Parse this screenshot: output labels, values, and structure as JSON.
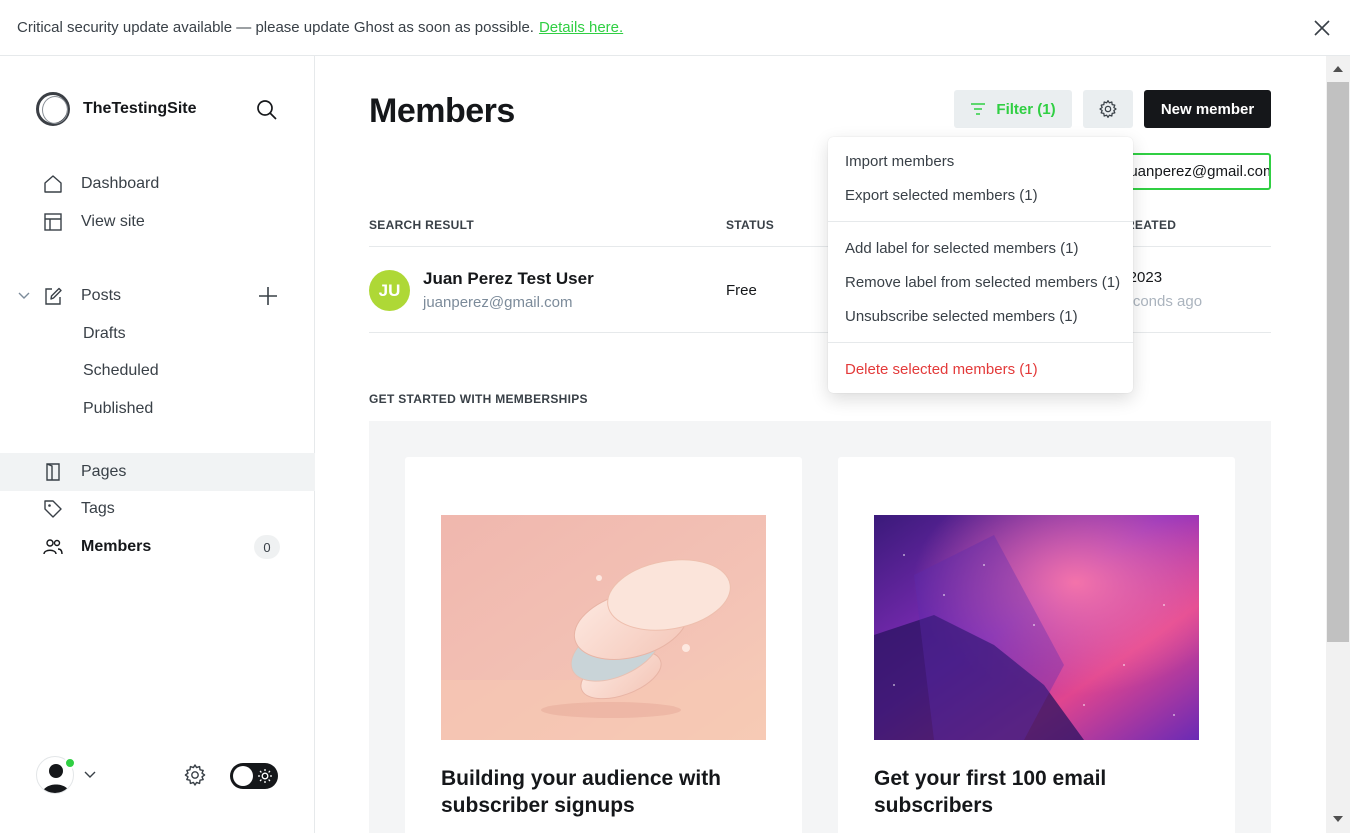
{
  "banner": {
    "message": "Critical security update available — please update Ghost as soon as possible.",
    "link_text": "Details here."
  },
  "sidebar": {
    "site_name": "TheTestingSite",
    "nav": {
      "dashboard": "Dashboard",
      "view_site": "View site",
      "posts": "Posts",
      "drafts": "Drafts",
      "scheduled": "Scheduled",
      "published": "Published",
      "pages": "Pages",
      "tags": "Tags",
      "members": "Members",
      "members_count": "0"
    }
  },
  "main": {
    "title": "Members",
    "filter_label": "Filter (1)",
    "new_member_label": "New member",
    "search_value": "juanperez@gmail.com",
    "table": {
      "headers": [
        "SEARCH RESULT",
        "STATUS",
        "CREATED"
      ],
      "rows": [
        {
          "initials": "JU",
          "name": "Juan Perez Test User",
          "email": "juanperez@gmail.com",
          "status": "Free",
          "created": "y 2023",
          "created_ago": "seconds ago"
        }
      ]
    },
    "get_started": {
      "heading": "GET STARTED WITH MEMBERSHIPS",
      "cards": [
        {
          "title": "Building your audience with subscriber signups"
        },
        {
          "title": "Get your first 100 email subscribers"
        }
      ]
    }
  },
  "dropdown": {
    "items": [
      "Import members",
      "Export selected members (1)",
      "Add label for selected members (1)",
      "Remove label from selected members (1)",
      "Unsubscribe selected members (1)",
      "Delete selected members (1)"
    ]
  },
  "colors": {
    "accent_green": "#30cf43",
    "danger_red": "#e33a3a",
    "dark": "#15171a",
    "avatar_green": "#aed836"
  }
}
